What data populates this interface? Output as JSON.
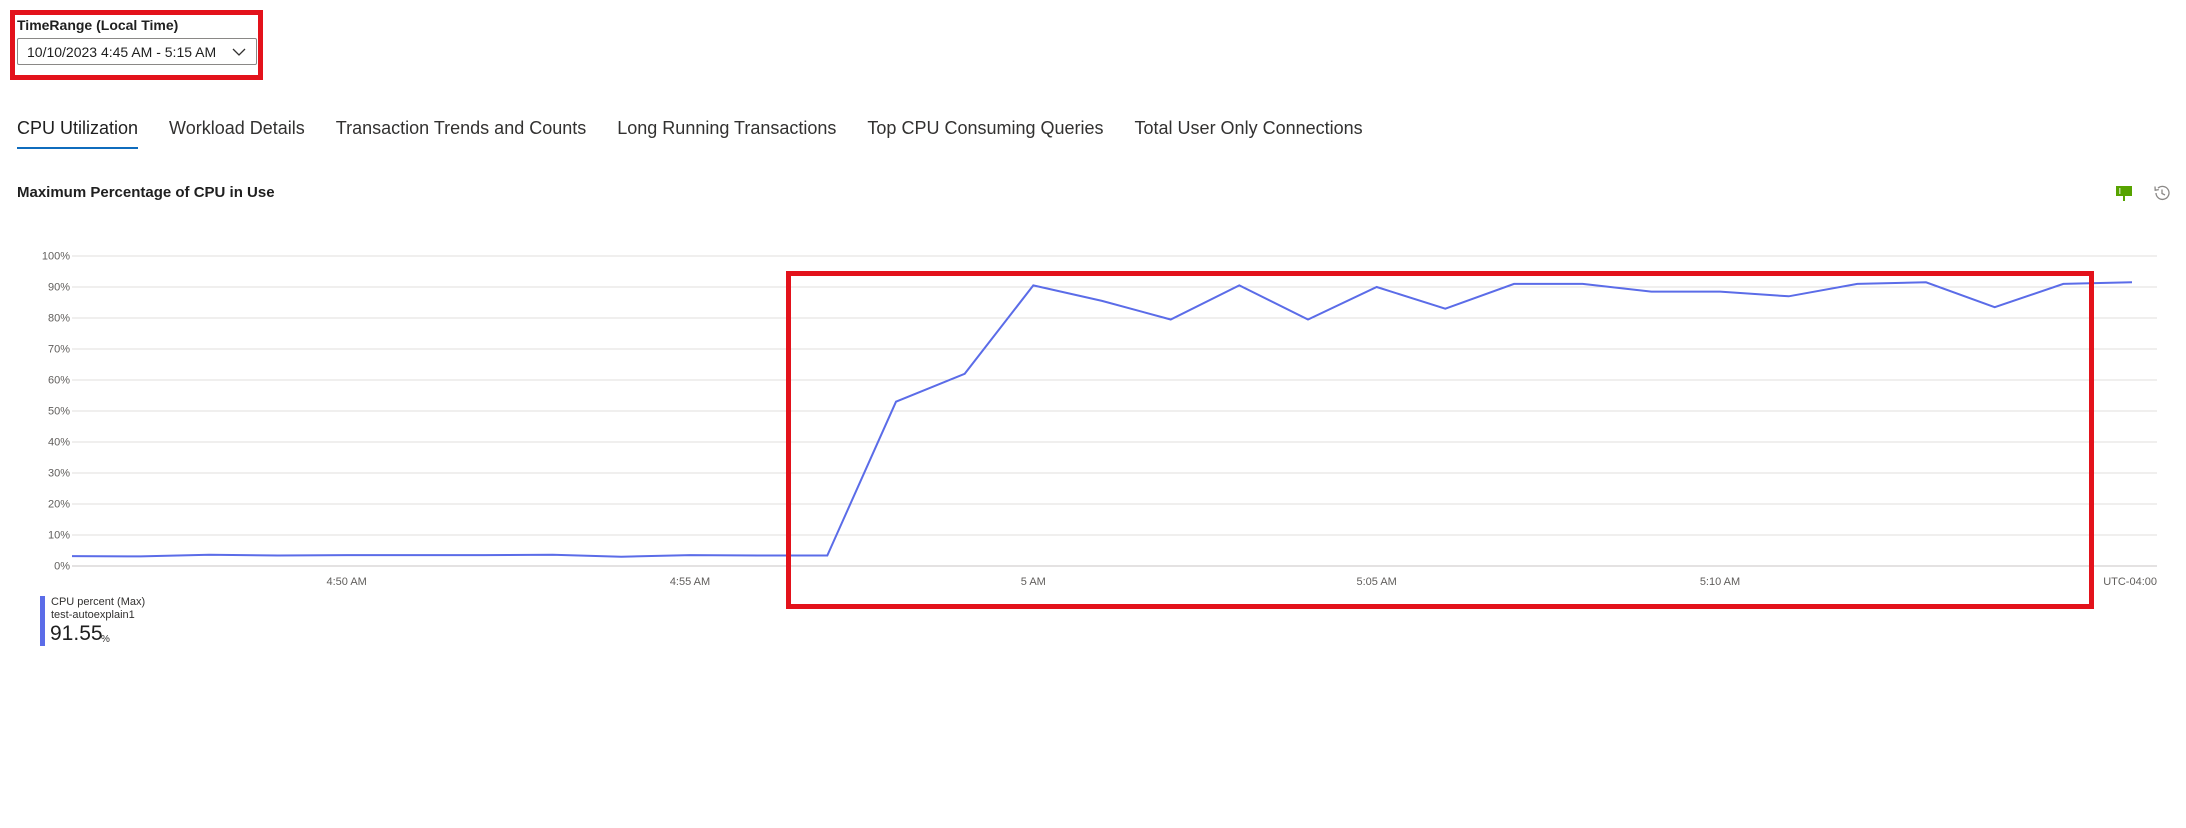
{
  "time_range": {
    "label": "TimeRange (Local Time)",
    "value": "10/10/2023 4:45 AM - 5:15 AM"
  },
  "tabs": [
    {
      "label": "CPU Utilization",
      "active": true
    },
    {
      "label": "Workload Details",
      "active": false
    },
    {
      "label": "Transaction Trends and Counts",
      "active": false
    },
    {
      "label": "Long Running Transactions",
      "active": false
    },
    {
      "label": "Top CPU Consuming Queries",
      "active": false
    },
    {
      "label": "Total User Only Connections",
      "active": false
    }
  ],
  "chart_header": {
    "title": "Maximum Percentage of CPU in Use",
    "icons": [
      "pin-icon",
      "history-icon"
    ]
  },
  "colors": {
    "series": "#5b6ce8",
    "highlight": "#e3121b",
    "tab_active": "#0f6cbd",
    "grid": "#e1dfdd"
  },
  "chart_data": {
    "type": "line",
    "title": "Maximum Percentage of CPU in Use",
    "xlabel": "",
    "ylabel": "",
    "timezone_label": "UTC-04:00",
    "ylim": [
      0,
      100
    ],
    "y_ticks": [
      "0%",
      "10%",
      "20%",
      "30%",
      "40%",
      "50%",
      "60%",
      "70%",
      "80%",
      "90%",
      "100%"
    ],
    "x_range": [
      "4:46",
      "5:16"
    ],
    "x_ticks": [
      {
        "t": "4:50",
        "label": "4:50 AM"
      },
      {
        "t": "4:55",
        "label": "4:55 AM"
      },
      {
        "t": "5:00",
        "label": "5 AM"
      },
      {
        "t": "5:05",
        "label": "5:05 AM"
      },
      {
        "t": "5:10",
        "label": "5:10 AM"
      }
    ],
    "grid": true,
    "series": [
      {
        "name": "CPU percent (Max)",
        "resource": "test-autoexplain1",
        "summary_value": "91.55",
        "summary_unit": "%",
        "points": [
          {
            "t": "4:46",
            "v": 3.2
          },
          {
            "t": "4:47",
            "v": 3.1
          },
          {
            "t": "4:48",
            "v": 3.6
          },
          {
            "t": "4:49",
            "v": 3.4
          },
          {
            "t": "4:50",
            "v": 3.5
          },
          {
            "t": "4:51",
            "v": 3.5
          },
          {
            "t": "4:52",
            "v": 3.5
          },
          {
            "t": "4:53",
            "v": 3.6
          },
          {
            "t": "4:54",
            "v": 3.0
          },
          {
            "t": "4:55",
            "v": 3.5
          },
          {
            "t": "4:56",
            "v": 3.4
          },
          {
            "t": "4:57",
            "v": 3.4
          },
          {
            "t": "4:58",
            "v": 53.0
          },
          {
            "t": "4:59",
            "v": 62.0
          },
          {
            "t": "5:00",
            "v": 90.5
          },
          {
            "t": "5:01",
            "v": 85.5
          },
          {
            "t": "5:02",
            "v": 79.5
          },
          {
            "t": "5:03",
            "v": 90.5
          },
          {
            "t": "5:04",
            "v": 79.5
          },
          {
            "t": "5:05",
            "v": 90.0
          },
          {
            "t": "5:06",
            "v": 83.0
          },
          {
            "t": "5:07",
            "v": 91.0
          },
          {
            "t": "5:08",
            "v": 91.0
          },
          {
            "t": "5:09",
            "v": 88.5
          },
          {
            "t": "5:10",
            "v": 88.5
          },
          {
            "t": "5:11",
            "v": 87.0
          },
          {
            "t": "5:12",
            "v": 91.0
          },
          {
            "t": "5:13",
            "v": 91.5
          },
          {
            "t": "5:14",
            "v": 83.5
          },
          {
            "t": "5:15",
            "v": 91.0
          },
          {
            "t": "5:16",
            "v": 91.5
          }
        ]
      }
    ]
  }
}
